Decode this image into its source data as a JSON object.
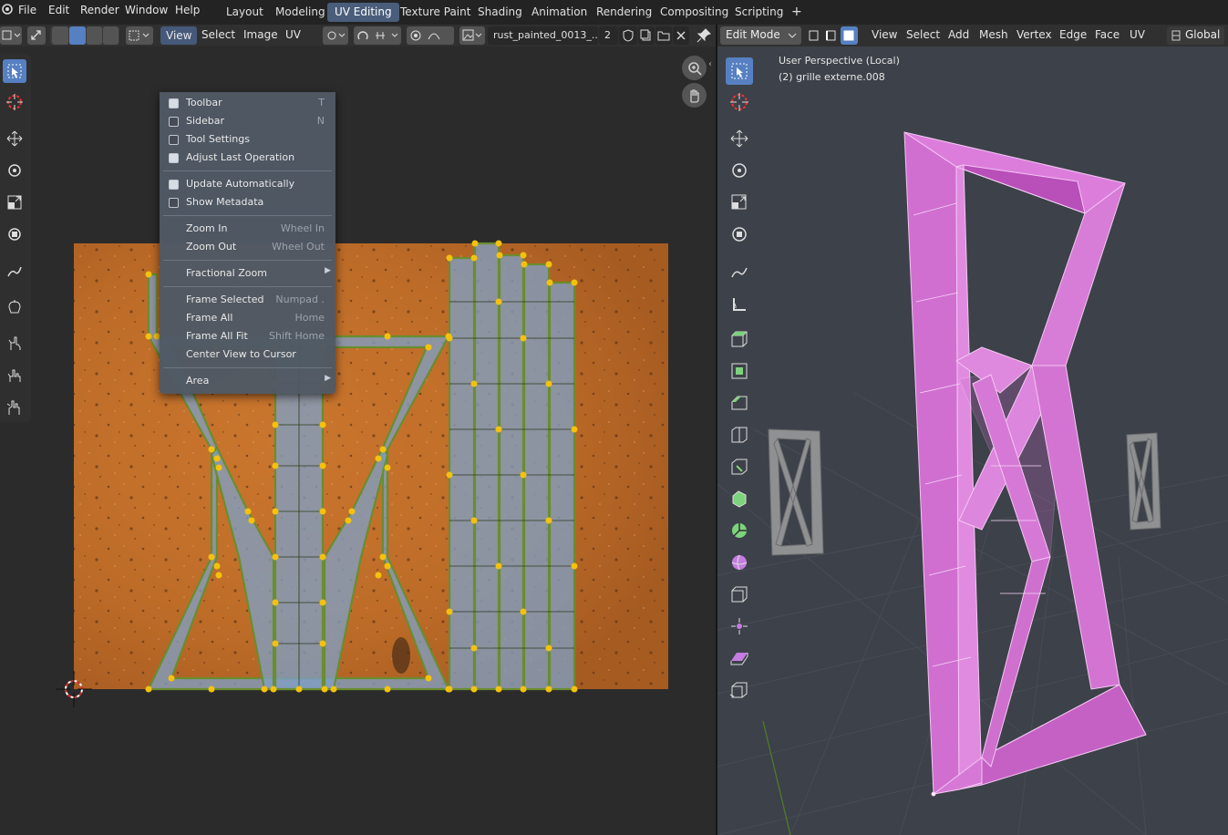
{
  "topbar": {
    "menus": [
      "File",
      "Edit",
      "Render",
      "Window",
      "Help"
    ],
    "workspaces": [
      "Layout",
      "Modeling",
      "UV Editing",
      "Texture Paint",
      "Shading",
      "Animation",
      "Rendering",
      "Compositing",
      "Scripting"
    ],
    "active_workspace": "UV Editing",
    "add_tab": "+"
  },
  "uv_header": {
    "menus": [
      "View",
      "Select",
      "Image",
      "UV"
    ],
    "image_name": "rust_painted_0013_...",
    "users_count": "2"
  },
  "viewport_header": {
    "mode": "Edit Mode",
    "menus": [
      "View",
      "Select",
      "Add",
      "Mesh",
      "Vertex",
      "Edge",
      "Face",
      "UV"
    ],
    "orientation": "Global"
  },
  "view_menu": {
    "items": [
      {
        "label": "Toolbar",
        "shortcut": "T",
        "checkbox": true,
        "checked": true
      },
      {
        "label": "Sidebar",
        "shortcut": "N",
        "checkbox": true,
        "checked": false
      },
      {
        "label": "Tool Settings",
        "shortcut": "",
        "checkbox": true,
        "checked": false
      },
      {
        "label": "Adjust Last Operation",
        "shortcut": "",
        "checkbox": true,
        "checked": true
      },
      {
        "label": "Update Automatically",
        "shortcut": "",
        "checkbox": true,
        "checked": true
      },
      {
        "label": "Show Metadata",
        "shortcut": "",
        "checkbox": true,
        "checked": false
      },
      {
        "label": "Zoom In",
        "shortcut": "Wheel In",
        "checkbox": false
      },
      {
        "label": "Zoom Out",
        "shortcut": "Wheel Out",
        "checkbox": false
      },
      {
        "label": "Fractional Zoom",
        "shortcut": "",
        "checkbox": false,
        "submenu": true
      },
      {
        "label": "Frame Selected",
        "shortcut": "Numpad .",
        "checkbox": false
      },
      {
        "label": "Frame All",
        "shortcut": "Home",
        "checkbox": false
      },
      {
        "label": "Frame All Fit",
        "shortcut": "Shift Home",
        "checkbox": false
      },
      {
        "label": "Center View to Cursor",
        "shortcut": "",
        "checkbox": false
      },
      {
        "label": "Area",
        "shortcut": "",
        "checkbox": false,
        "submenu": true
      }
    ]
  },
  "viewport": {
    "perspective_label": "User Perspective (Local)",
    "object_label": "(2) grille externe.008"
  },
  "colors": {
    "accent": "#5680c2",
    "texture": "#c8732e",
    "uv_vertex": "#f4c20d",
    "uv_edge": "#6a8d2f",
    "uv_face": "#7f9fc4",
    "mesh_selected": "#d86fd8",
    "viewport_bg": "#3d4149"
  },
  "icons": [
    "blender-logo-icon",
    "select-box-icon",
    "cursor-icon",
    "move-icon",
    "rotate-icon",
    "scale-icon",
    "transform-icon",
    "annotate-icon",
    "measure-icon",
    "extrude-icon",
    "inset-icon",
    "bevel-icon",
    "loop-cut-icon",
    "knife-icon",
    "poly-build-icon",
    "spin-icon",
    "smooth-icon",
    "edge-slide-icon",
    "shrink-fatten-icon",
    "shear-icon",
    "rip-icon",
    "grab-icon",
    "pinch-icon",
    "relax-icon",
    "zoom-icon",
    "hand-icon",
    "pin-icon",
    "close-icon"
  ]
}
